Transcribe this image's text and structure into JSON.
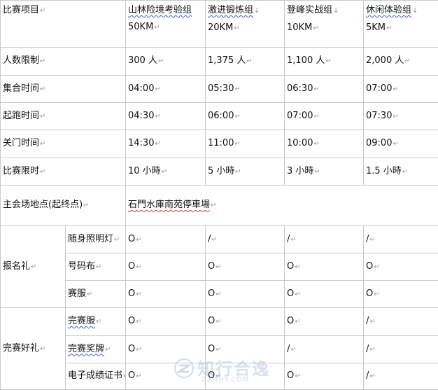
{
  "header": {
    "label": "比赛项目",
    "groups": [
      {
        "name": "山林险境考验组",
        "distance": "50KM"
      },
      {
        "name": "激进锻炼组",
        "distance": "20KM"
      },
      {
        "name": "登峰实战组",
        "distance": "10KM"
      },
      {
        "name": "休闲体验组",
        "distance": "5KM"
      }
    ]
  },
  "rows": [
    {
      "label": "人数限制",
      "values": [
        "300 人",
        "1,375 人",
        "1,100 人",
        "2,000 人"
      ]
    },
    {
      "label": "集合时间",
      "values": [
        "04:00",
        "05:30",
        "06:30",
        "07:00"
      ]
    },
    {
      "label": "起跑时间",
      "values": [
        "04:30",
        "06:00",
        "07:00",
        "07:30"
      ]
    },
    {
      "label": "关门时间",
      "values": [
        "14:30",
        "11:00",
        "10:00",
        "09:00"
      ]
    },
    {
      "label": "比赛限时",
      "values": [
        "10 小時",
        "5 小時",
        "3 小時",
        "1.5 小時"
      ]
    }
  ],
  "venue": {
    "label": "主会场地点(起终点)",
    "value": "石門水庫南苑停車場"
  },
  "registration": {
    "label": "报名礼",
    "items": [
      {
        "label": "随身照明灯",
        "values": [
          "O",
          "/",
          "/",
          "/"
        ]
      },
      {
        "label": "号码布",
        "values": [
          "O",
          "O",
          "O",
          "O"
        ]
      },
      {
        "label": "赛服",
        "values": [
          "O",
          "O",
          "O",
          "O"
        ]
      }
    ]
  },
  "finisher": {
    "label": "完赛好礼",
    "items": [
      {
        "label": "完赛服",
        "values": [
          "O",
          "O",
          "O",
          "/"
        ]
      },
      {
        "label": "完赛奖牌",
        "values": [
          "O",
          "O",
          "/",
          "/"
        ]
      },
      {
        "label": "电子成绩证书",
        "values": [
          "O",
          "O",
          "O",
          "/"
        ]
      }
    ]
  },
  "marks": {
    "paragraph": "↵",
    "down": "↓"
  },
  "watermark": {
    "text": "知行合逸",
    "sub": "ZXHHY.COM"
  }
}
